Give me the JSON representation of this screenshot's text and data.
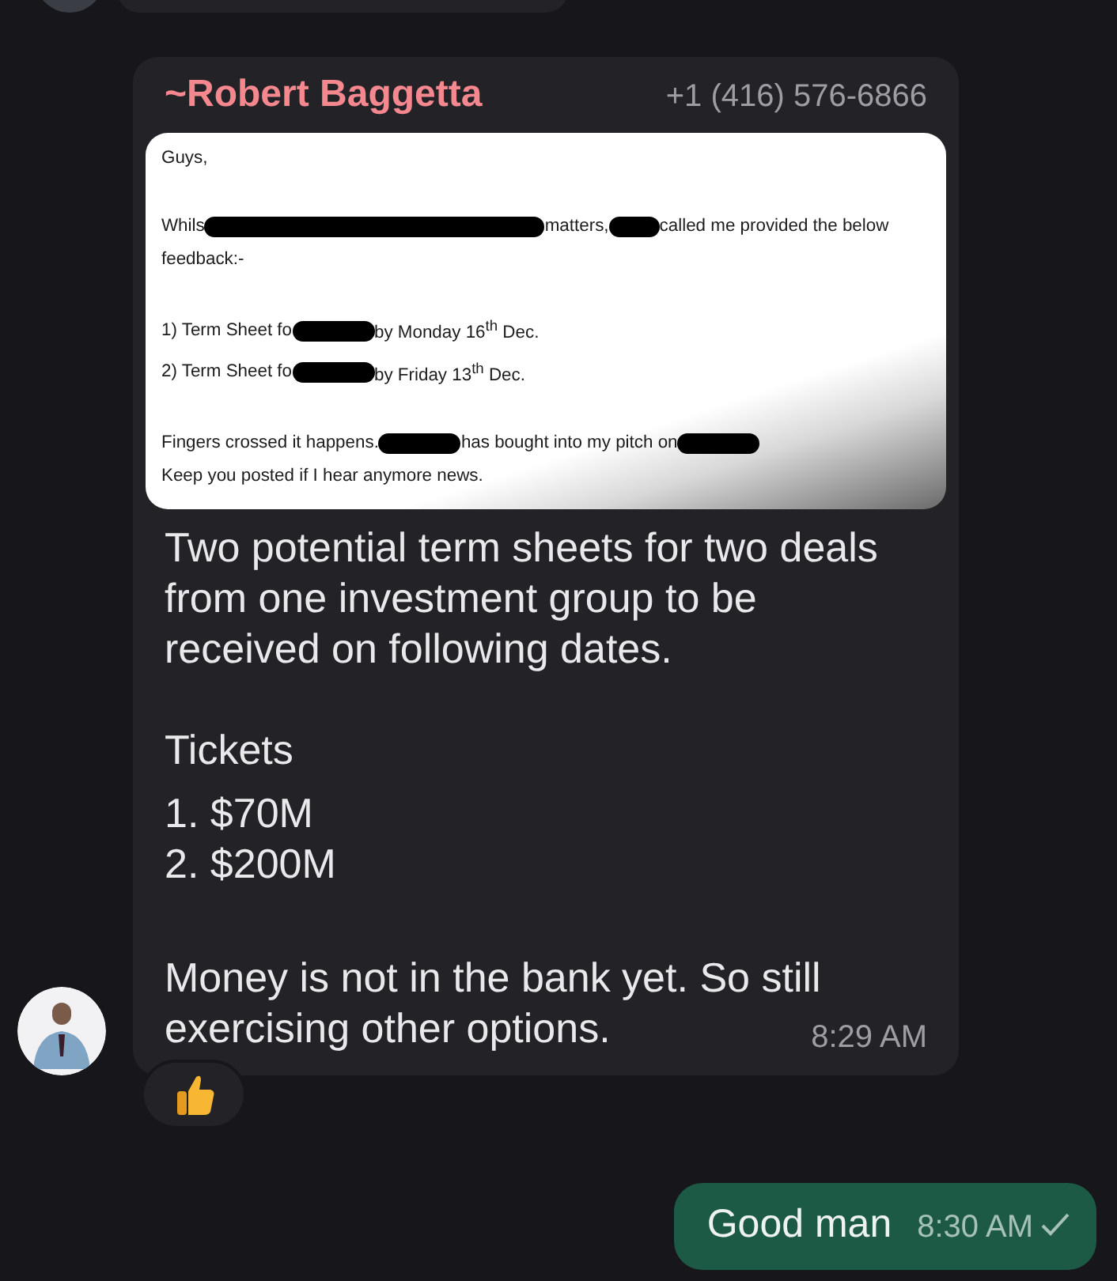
{
  "messages": [
    {
      "kind": "incoming_cut"
    },
    {
      "kind": "incoming",
      "sender": "~Robert Baggetta",
      "phone": "+1 (416) 576-6866",
      "time": "8:29 AM",
      "reaction": {
        "kind": "thumbs_up"
      },
      "attachment": {
        "paragraphs": [
          [
            [
              {
                "text": "Guys,"
              }
            ]
          ],
          [
            [
              {
                "text": "Whils"
              },
              {
                "kind": "redaction_wide"
              },
              {
                "text": "matters,"
              },
              {
                "kind": "redaction_small"
              },
              {
                "text": "called me provided the below"
              }
            ],
            [
              {
                "text": "feedback:-"
              }
            ]
          ],
          [
            [
              {
                "text": "1) Term Sheet fo"
              },
              {
                "kind": "redaction"
              },
              {
                "text": "by Monday 16$^{th}$ Dec."
              }
            ],
            [
              {
                "text": "2) Term Sheet fo"
              },
              {
                "kind": "redaction"
              },
              {
                "text": "by Friday 13$^{th}$ Dec."
              }
            ]
          ],
          [
            [
              {
                "text": "Fingers crossed it happens."
              },
              {
                "kind": "redaction"
              },
              {
                "text": "has bought into my pitch on"
              },
              {
                "kind": "redaction"
              }
            ],
            [
              {
                "text": "Keep you posted if I hear anymore news."
              }
            ]
          ]
        ]
      },
      "body": [
        {
          "kind": "paragraph",
          "text": "Two potential term sheets for two deals from one investment group to be received on following dates."
        },
        {
          "kind": "paragraph",
          "text": "Tickets"
        },
        {
          "kind": "list_item",
          "text": "1. $70M"
        },
        {
          "kind": "list_item",
          "text": "2. $200M"
        },
        {
          "kind": "paragraph",
          "text": "Money is not in the bank yet. So still exercising other options."
        }
      ]
    },
    {
      "kind": "outgoing",
      "text": "Good man",
      "time": "8:30 AM",
      "sent": true
    }
  ]
}
